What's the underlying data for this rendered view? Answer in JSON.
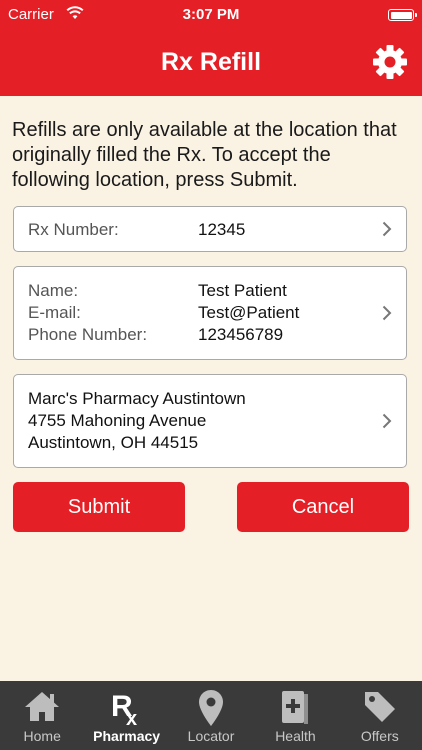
{
  "status_bar": {
    "carrier": "Carrier",
    "time": "3:07 PM"
  },
  "nav": {
    "title": "Rx Refill",
    "settings_icon": "gear-icon"
  },
  "intro_text": "Refills are only available at the location that originally filled the Rx. To accept the following location, press Submit.",
  "rx": {
    "label": "Rx Number:",
    "value": "12345"
  },
  "patient": {
    "name_label": "Name:",
    "name_value": "Test Patient",
    "email_label": "E-mail:",
    "email_value": "Test@Patient",
    "phone_label": "Phone Number:",
    "phone_value": "123456789"
  },
  "pharmacy": {
    "name": "Marc's Pharmacy Austintown",
    "address": "4755 Mahoning Avenue",
    "city": "Austintown, OH 44515"
  },
  "buttons": {
    "submit": "Submit",
    "cancel": "Cancel"
  },
  "tabs": [
    {
      "label": "Home",
      "icon": "home-icon"
    },
    {
      "label": "Pharmacy",
      "icon": "rx-icon",
      "active": true
    },
    {
      "label": "Locator",
      "icon": "location-pin-icon"
    },
    {
      "label": "Health",
      "icon": "book-icon"
    },
    {
      "label": "Offers",
      "icon": "tag-icon"
    }
  ],
  "colors": {
    "brand_red": "#e41f26",
    "background": "#faf2e3",
    "tab_bar": "#3a3a3a"
  }
}
